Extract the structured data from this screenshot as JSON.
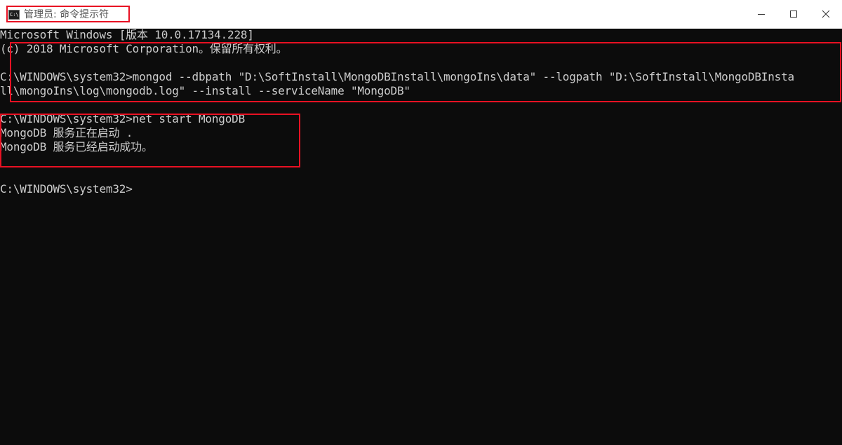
{
  "window": {
    "title": "管理员: 命令提示符",
    "icon": "cmd-icon",
    "icon_glyph": "C:\\",
    "controls": {
      "minimize": "minimize-icon",
      "maximize": "maximize-icon",
      "close": "close-icon"
    },
    "highlight_color": "#e81123"
  },
  "console": {
    "lines": [
      "Microsoft Windows [版本 10.0.17134.228]",
      "(c) 2018 Microsoft Corporation。保留所有权利。",
      "",
      "C:\\WINDOWS\\system32>mongod --dbpath \"D:\\SoftInstall\\MongoDBInstall\\mongoIns\\data\" --logpath \"D:\\SoftInstall\\MongoDBInsta",
      "ll\\mongoIns\\log\\mongodb.log\" --install --serviceName \"MongoDB\"",
      "",
      "C:\\WINDOWS\\system32>net start MongoDB",
      "MongoDB 服务正在启动 .",
      "MongoDB 服务已经启动成功。",
      "",
      "",
      "C:\\WINDOWS\\system32>"
    ],
    "text_color": "#cccccc",
    "background": "#0c0c0c"
  }
}
